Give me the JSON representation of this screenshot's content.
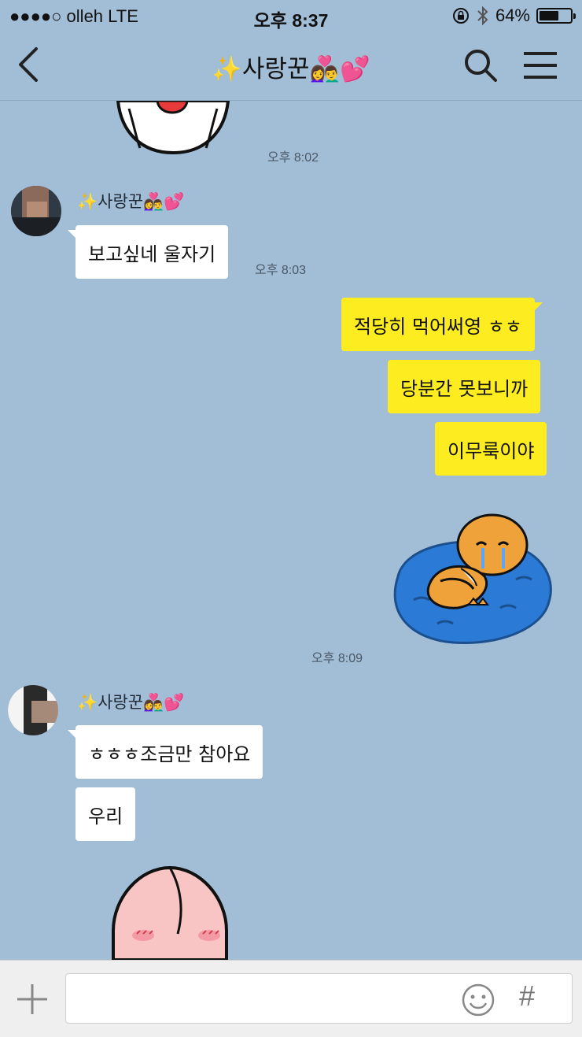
{
  "status_bar": {
    "carrier": "●●●●○ olleh   LTE",
    "time": "오후 8:37",
    "battery": "64%",
    "battery_level": 0.64
  },
  "header": {
    "title": "✨사랑꾼👩‍❤️‍👨💕",
    "back_icon": "chevron-left-icon",
    "search_icon": "search-icon",
    "menu_icon": "hamburger-menu-icon"
  },
  "messages": {
    "time_802": "오후 8:02",
    "group1": {
      "sender": "✨사랑꾼👩‍❤️‍👨💕",
      "text": "보고싶네 울자기",
      "time": "오후 8:03"
    },
    "mine": {
      "m1": "적당히 먹어써영 ㅎㅎ",
      "m2": "당분간 못보니까",
      "m3": "이무룩이야"
    },
    "time_809": "오후 8:09",
    "group2": {
      "sender": "✨사랑꾼👩‍❤️‍👨💕",
      "text1": "ㅎㅎㅎ조금만 참아요",
      "text2": "우리"
    }
  },
  "input_bar": {
    "placeholder": "",
    "plus_icon": "plus-icon",
    "emoji_icon": "smiley-icon",
    "hash_label": "#"
  }
}
